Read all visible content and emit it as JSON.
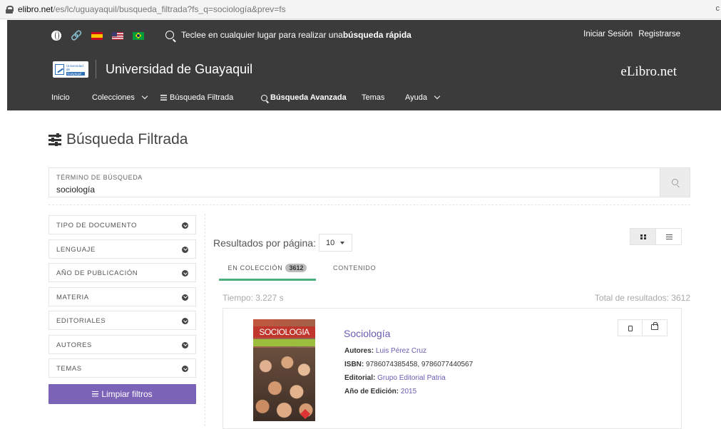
{
  "browser": {
    "url_host": "elibro.net",
    "url_path": "/es/lc/uguayaquil/busqueda_filtrada?fs_q=sociología&prev=fs",
    "edge_glyph": "c"
  },
  "header": {
    "quick_search_prefix": "Teclee en cualquier lugar para realizar una ",
    "quick_search_bold": "búsqueda rápida",
    "login": "Iniciar Sesión",
    "register": "Registrarse",
    "logo_text_line1": "Universidad de",
    "logo_text_line2": "Guayaquil",
    "university": "Universidad de Guayaquil",
    "brand": "eLibro.net"
  },
  "nav": {
    "inicio": "Inicio",
    "colecciones": "Colecciones",
    "busqueda_filtrada": "Búsqueda Filtrada",
    "busqueda_avanzada": "Búsqueda Avanzada",
    "temas": "Temas",
    "ayuda": "Ayuda"
  },
  "page": {
    "title": "Búsqueda Filtrada"
  },
  "search": {
    "label": "TÉRMINO DE BÚSQUEDA",
    "value": "sociología"
  },
  "filters": [
    {
      "label": "TIPO DE DOCUMENTO"
    },
    {
      "label": "LENGUAJE"
    },
    {
      "label": "AÑO DE PUBLICACIÓN"
    },
    {
      "label": "MATERIA"
    },
    {
      "label": "EDITORIALES"
    },
    {
      "label": "AUTORES"
    },
    {
      "label": "TEMAS"
    }
  ],
  "clear_filters": "Limpiar filtros",
  "results": {
    "per_page_label": "Resultados por página:",
    "per_page_value": "10",
    "tab_collection": "EN COLECCIÓN",
    "tab_collection_count": "3612",
    "tab_content": "CONTENIDO",
    "time": "Tiempo: 3.227 s",
    "total": "Total de resultados: 3612"
  },
  "book": {
    "cover_text": "SOCIOLOGIA",
    "title": "Sociología",
    "authors_label": "Autores:",
    "authors": "Luis Pérez Cruz",
    "isbn_label": "ISBN:",
    "isbn": "9786074385458, 9786077440567",
    "publisher_label": "Editorial:",
    "publisher": "Grupo Editorial Patria",
    "year_label": "Año de Edición:",
    "year": "2015"
  },
  "colors": {
    "header_bg": "#3b3b3b",
    "accent_purple": "#7b63b8",
    "link_purple": "#6c5bb0",
    "tab_green": "#4caf7f"
  }
}
